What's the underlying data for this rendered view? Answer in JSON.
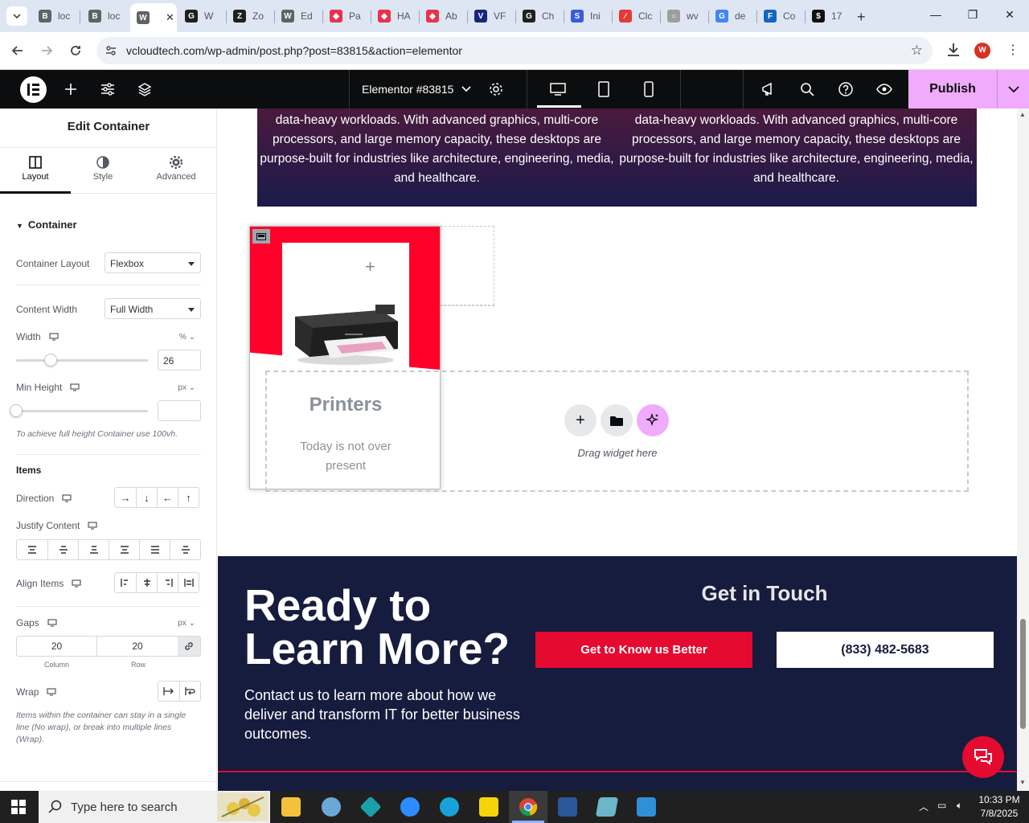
{
  "browser": {
    "tabs": [
      {
        "label": "loc",
        "color": "#5f6368",
        "fav": "B"
      },
      {
        "label": "loc",
        "color": "#5f6368",
        "fav": "B"
      },
      {
        "label": "",
        "color": "#5f6368",
        "fav": "W"
      },
      {
        "label": "W",
        "color": "#1f1f1f",
        "fav": "G"
      },
      {
        "label": "Zo",
        "color": "#1f1f1f",
        "fav": "Z"
      },
      {
        "label": "Ed",
        "color": "#5f6368",
        "fav": "W"
      },
      {
        "label": "Pa",
        "color": "#e8334a",
        "fav": "◆"
      },
      {
        "label": "HA",
        "color": "#e8334a",
        "fav": "◆"
      },
      {
        "label": "Ab",
        "color": "#e8334a",
        "fav": "◆"
      },
      {
        "label": "VF",
        "color": "#1a237e",
        "fav": "V"
      },
      {
        "label": "Ch",
        "color": "#1f1f1f",
        "fav": "G"
      },
      {
        "label": "Ini",
        "color": "#3b5bdb",
        "fav": "S"
      },
      {
        "label": "Clc",
        "color": "#e53935",
        "fav": "∕"
      },
      {
        "label": "wv",
        "color": "#9e9e9e",
        "fav": "○"
      },
      {
        "label": "de",
        "color": "#4285f4",
        "fav": "G"
      },
      {
        "label": "Co",
        "color": "#1565c0",
        "fav": "F"
      },
      {
        "label": "17",
        "color": "#111",
        "fav": "$"
      }
    ],
    "url": "vcloudtech.com/wp-admin/post.php?post=83815&action=elementor",
    "profile_initial": "W"
  },
  "editor": {
    "document_title": "Elementor #83815",
    "publish_label": "Publish"
  },
  "panel": {
    "title": "Edit Container",
    "tabs": {
      "layout": "Layout",
      "style": "Style",
      "advanced": "Advanced"
    },
    "section_container": "Container",
    "container_layout_label": "Container Layout",
    "container_layout_value": "Flexbox",
    "content_width_label": "Content Width",
    "content_width_value": "Full Width",
    "width_label": "Width",
    "width_unit": "%",
    "width_value": "26",
    "width_fraction": 0.26,
    "min_height_label": "Min Height",
    "min_height_unit": "px",
    "min_height_hint": "To achieve full height Container use 100vh.",
    "items_heading": "Items",
    "direction_label": "Direction",
    "justify_label": "Justify Content",
    "align_label": "Align Items",
    "gaps_label": "Gaps",
    "gaps_unit": "px",
    "gap_column": "20",
    "gap_row": "20",
    "gap_column_label": "Column",
    "gap_row_label": "Row",
    "wrap_label": "Wrap",
    "wrap_hint": "Items within the container can stay in a single line (No wrap), or break into multiple lines (Wrap)."
  },
  "page": {
    "hero_left": "data-heavy workloads. With advanced graphics, multi-core processors, and large memory capacity, these desktops are purpose-built for industries like architecture, engineering, media, and healthcare.",
    "hero_right": "data-heavy workloads. With advanced graphics, multi-core processors, and large memory capacity, these desktops are purpose-built for industries like architecture, engineering, media, and healthcare.",
    "card_title": "Printers",
    "card_subtitle": "Today is not over present",
    "drag_text": "Drag widget here",
    "cta_heading": "Ready to Learn More?",
    "cta_sub": "Contact us to learn more about how we deliver and transform IT for better business outcomes.",
    "get_in_touch": "Get in Touch",
    "btn_know": "Get to Know us Better",
    "btn_phone": "(833) 482-5683"
  },
  "taskbar": {
    "search_placeholder": "Type here to search",
    "time": "10:33 PM",
    "date": "7/8/2025"
  }
}
